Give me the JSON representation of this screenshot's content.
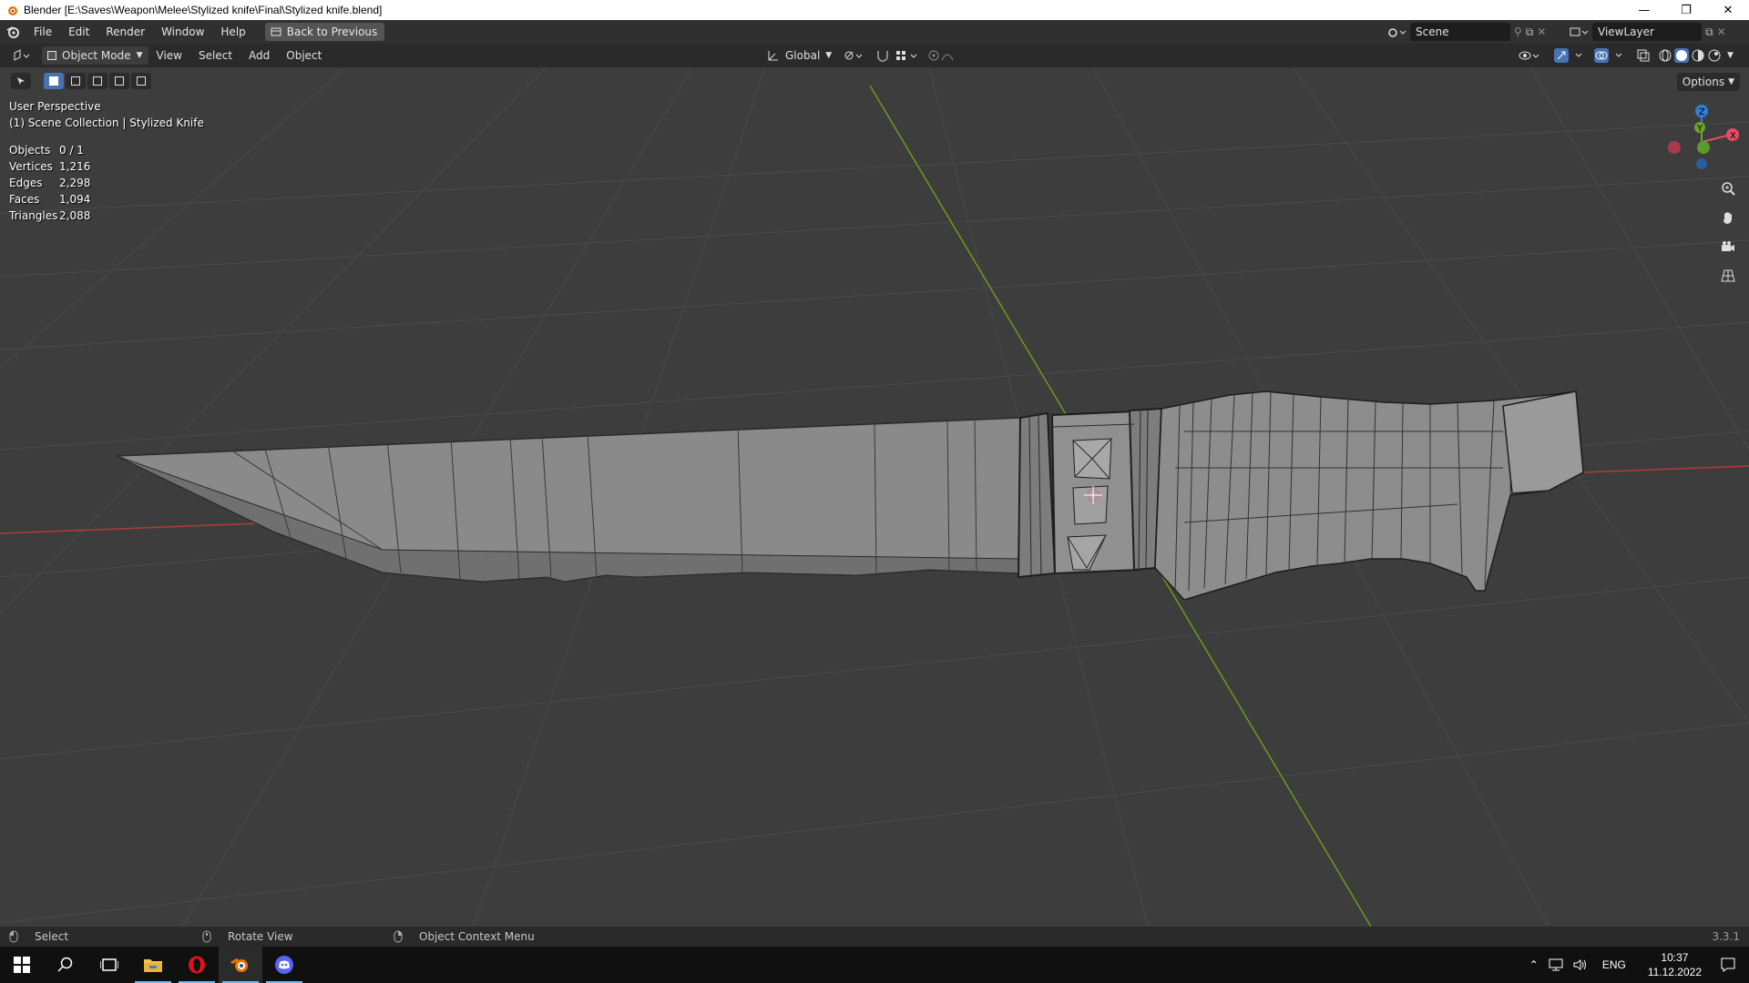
{
  "window": {
    "title": "Blender [E:\\Saves\\Weapon\\Melee\\Stylized knife\\Final\\Stylized knife.blend]",
    "controls": [
      "minimize",
      "restore",
      "close"
    ]
  },
  "topbar": {
    "menus": [
      "File",
      "Edit",
      "Render",
      "Window",
      "Help"
    ],
    "back_button": "Back to Previous",
    "scene_name": "Scene",
    "view_layer": "ViewLayer"
  },
  "viewport_header": {
    "mode": "Object Mode",
    "menus": [
      "View",
      "Select",
      "Add",
      "Object"
    ],
    "orientation": "Global",
    "options_label": "Options"
  },
  "viewport": {
    "perspective": "User Perspective",
    "collection": "(1) Scene Collection | Stylized Knife",
    "stats": [
      {
        "label": "Objects",
        "value": "0 / 1"
      },
      {
        "label": "Vertices",
        "value": "1,216"
      },
      {
        "label": "Edges",
        "value": "2,298"
      },
      {
        "label": "Faces",
        "value": "1,094"
      },
      {
        "label": "Triangles",
        "value": "2,088"
      }
    ],
    "gizmo": {
      "x_color": "#e84d63",
      "y_color": "#6ba32b",
      "z_color": "#2f7fdb",
      "labels": [
        "X",
        "Y",
        "Z"
      ]
    }
  },
  "statusbar": {
    "select": "Select",
    "rotate": "Rotate View",
    "context": "Object Context Menu",
    "version": "3.3.1"
  },
  "taskbar": {
    "language": "ENG",
    "time": "10:37",
    "date": "11.12.2022"
  },
  "colors": {
    "accent": "#4772b3",
    "viewport_bg": "#3d3d3d",
    "x_axis": "#b23b3b",
    "y_axis": "#6a9a1a"
  }
}
